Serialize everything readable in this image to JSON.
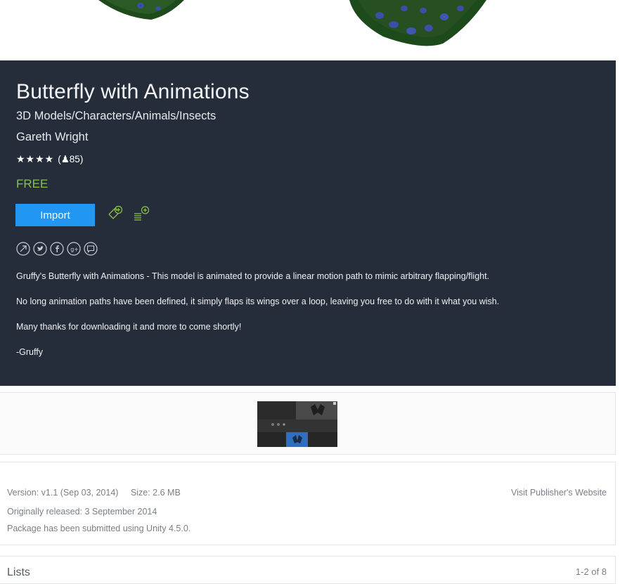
{
  "asset": {
    "title": "Butterfly with Animations",
    "category": "3D Models/Characters/Animals/Insects",
    "publisher": "Gareth Wright",
    "rating_stars": 4,
    "rating_stars_text": "★★★★",
    "rating_count_text": "(♙85)",
    "price": "FREE"
  },
  "actions": {
    "import_label": "Import"
  },
  "social_icons": [
    "share-icon",
    "twitter-icon",
    "facebook-icon",
    "google-plus-icon",
    "comment-icon"
  ],
  "description": [
    "Gruffy's Butterfly with Animations - This model is animated to provide a linear motion path to mimic arbitrary flapping/flight.",
    "No long animation paths have been defined, it simply flaps its wings over a loop, leaving you free to do with it what you wish.",
    "Many thanks for downloading it and more to come shortly!",
    "-Gruffy"
  ],
  "details": {
    "version": "Version: v1.1 (Sep 03, 2014)",
    "size": "Size: 2.6 MB",
    "released": "Originally released: 3 September 2014",
    "unity": "Package has been submitted using Unity 4.5.0.",
    "website_link": "Visit Publisher's Website"
  },
  "lists": {
    "label": "Lists",
    "range": "1-2 of 8"
  },
  "colors": {
    "panel_bg": "#262d3a",
    "import_button": "#2196f3",
    "price_green": "#85c441",
    "icon_green": "#8bc34a"
  }
}
